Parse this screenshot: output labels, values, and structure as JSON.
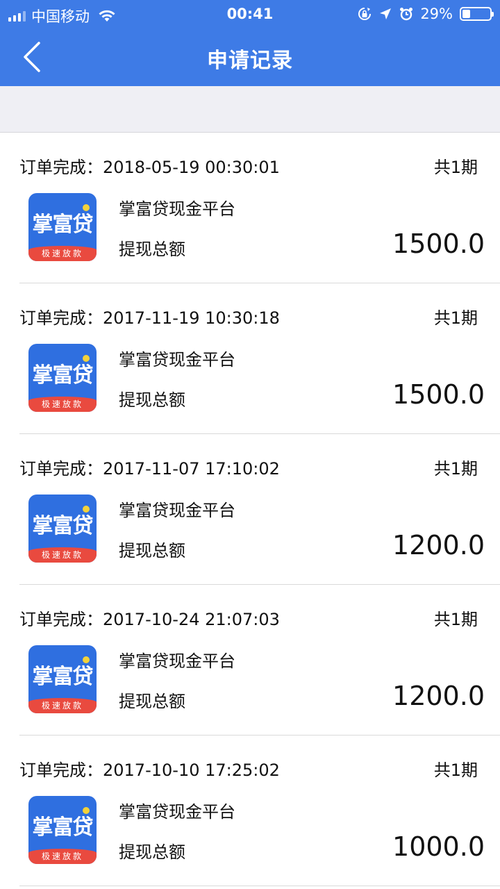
{
  "status_bar": {
    "carrier": "中国移动",
    "time": "00:41",
    "battery_percent": "29%",
    "battery_level": 0.29,
    "icons": [
      "signal-icon",
      "wifi-icon",
      "rotation-lock-icon",
      "location-icon",
      "alarm-icon",
      "battery-icon"
    ]
  },
  "navbar": {
    "title": "申请记录",
    "back_icon": "chevron-left-icon"
  },
  "colors": {
    "primary": "#3e7be6",
    "logo_blue": "#2f6fe0",
    "logo_red": "#e94a3f",
    "background_gray": "#efeff4"
  },
  "records": [
    {
      "label": "订单完成：",
      "time": "2018-05-19 00:30:01",
      "period": "共1期",
      "logo_text": "掌富贷",
      "logo_banner": "极速放款",
      "name": "掌富贷现金平台",
      "sublabel": "提现总额",
      "amount": "1500.0"
    },
    {
      "label": "订单完成：",
      "time": "2017-11-19 10:30:18",
      "period": "共1期",
      "logo_text": "掌富贷",
      "logo_banner": "极速放款",
      "name": "掌富贷现金平台",
      "sublabel": "提现总额",
      "amount": "1500.0"
    },
    {
      "label": "订单完成：",
      "time": "2017-11-07 17:10:02",
      "period": "共1期",
      "logo_text": "掌富贷",
      "logo_banner": "极速放款",
      "name": "掌富贷现金平台",
      "sublabel": "提现总额",
      "amount": "1200.0"
    },
    {
      "label": "订单完成：",
      "time": "2017-10-24 21:07:03",
      "period": "共1期",
      "logo_text": "掌富贷",
      "logo_banner": "极速放款",
      "name": "掌富贷现金平台",
      "sublabel": "提现总额",
      "amount": "1200.0"
    },
    {
      "label": "订单完成：",
      "time": "2017-10-10 17:25:02",
      "period": "共1期",
      "logo_text": "掌富贷",
      "logo_banner": "极速放款",
      "name": "掌富贷现金平台",
      "sublabel": "提现总额",
      "amount": "1000.0"
    }
  ]
}
